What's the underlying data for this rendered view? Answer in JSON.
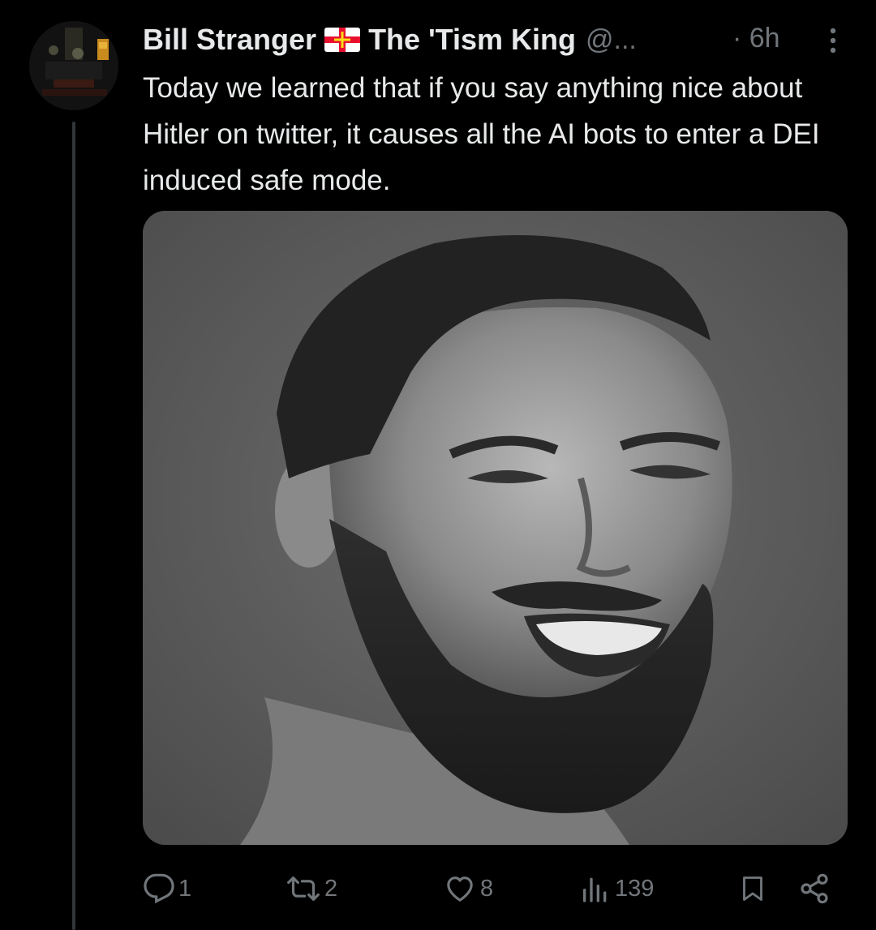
{
  "tweet": {
    "author_name": "Bill Stranger",
    "author_suffix": "The 'Tism King",
    "handle": "@...",
    "time": "· 6h",
    "text": "Today we learned that if you say anything nice about Hitler on twitter, it causes all the AI bots to enter a DEI induced safe mode."
  },
  "flag_icon": "flag-of-guernsey",
  "media": {
    "kind": "photo",
    "description_icon": "bearded-man-meme-image"
  },
  "actions": {
    "replies": "1",
    "reposts": "2",
    "likes": "8",
    "views": "139"
  },
  "colors": {
    "background": "#000000",
    "text": "#e7e9ea",
    "secondary": "#71767b",
    "thread_line": "#333639"
  }
}
